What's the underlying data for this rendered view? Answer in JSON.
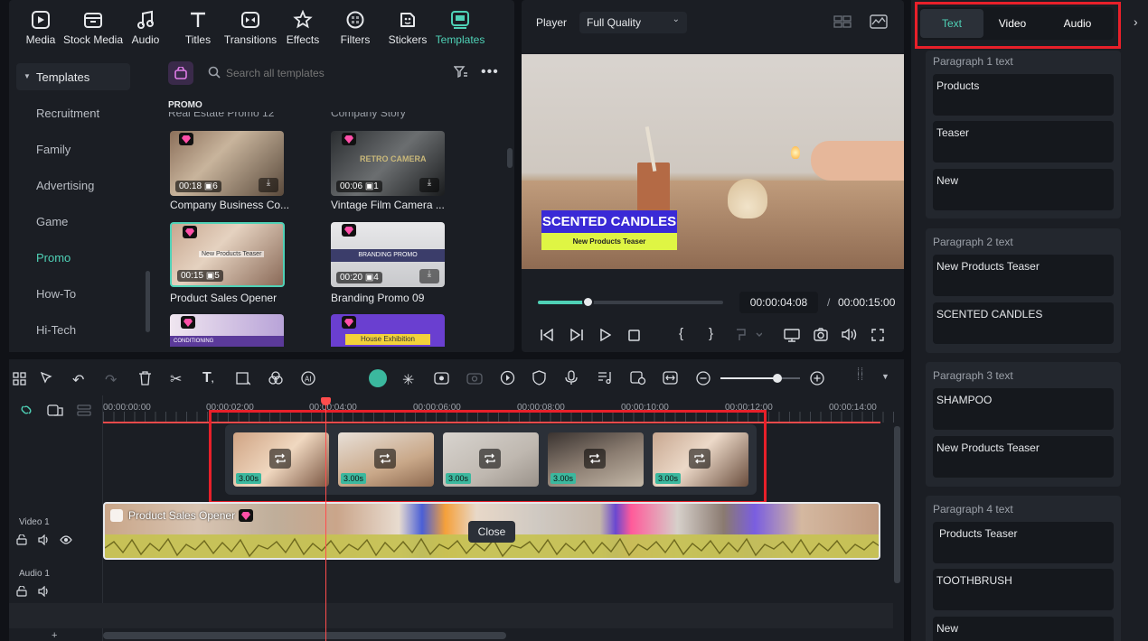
{
  "toolbar": {
    "items": [
      {
        "label": "Media",
        "icon": "media-icon"
      },
      {
        "label": "Stock Media",
        "icon": "stock-media-icon"
      },
      {
        "label": "Audio",
        "icon": "audio-icon"
      },
      {
        "label": "Titles",
        "icon": "titles-icon"
      },
      {
        "label": "Transitions",
        "icon": "transitions-icon"
      },
      {
        "label": "Effects",
        "icon": "effects-icon"
      },
      {
        "label": "Filters",
        "icon": "filters-icon"
      },
      {
        "label": "Stickers",
        "icon": "stickers-icon"
      },
      {
        "label": "Templates",
        "icon": "templates-icon"
      }
    ]
  },
  "sidebar": {
    "header": "Templates",
    "items": [
      "Recruitment",
      "Family",
      "Advertising",
      "Game",
      "Promo",
      "How-To",
      "Hi-Tech"
    ],
    "active": "Promo"
  },
  "search": {
    "placeholder": "Search all templates"
  },
  "grid": {
    "section": "PROMO",
    "cut_top_left": "Real Estate Promo 12",
    "cut_top_right": "Company Story",
    "cards": [
      {
        "caption": "Company Business Co...",
        "duration": "00:18",
        "count": "6"
      },
      {
        "caption": "Vintage Film Camera ...",
        "duration": "00:06",
        "count": "1",
        "overlay": "RETRO CAMERA"
      },
      {
        "caption": "Product Sales Opener",
        "duration": "00:15",
        "count": "5",
        "overlay": "New Products Teaser"
      },
      {
        "caption": "Branding Promo 09",
        "duration": "00:20",
        "count": "4",
        "overlay": "BRANDING PROMO"
      },
      {
        "overlay": "CONDITIONING"
      },
      {
        "overlay": "House Exhibition"
      }
    ]
  },
  "player": {
    "label": "Player",
    "quality": "Full Quality",
    "overlay_title": "SCENTED CANDLES",
    "overlay_sub": "New Products Teaser",
    "current_time": "00:00:04:08",
    "separator": "/",
    "total_time": "00:00:15:00",
    "progress": 0.27
  },
  "right_panel": {
    "tabs": [
      "Text",
      "Video",
      "Audio"
    ],
    "active_tab": "Text",
    "paragraphs": [
      {
        "title": "Paragraph 1 text",
        "texts": [
          "Products",
          "Teaser",
          "New"
        ]
      },
      {
        "title": "Paragraph 2 text",
        "texts": [
          "New Products Teaser",
          "SCENTED CANDLES"
        ]
      },
      {
        "title": "Paragraph 3 text",
        "texts": [
          "SHAMPOO",
          "New Products Teaser"
        ]
      },
      {
        "title": "Paragraph 4 text",
        "texts": [
          "Products Teaser",
          "TOOTHBRUSH",
          "New"
        ]
      }
    ]
  },
  "timeline": {
    "ticks": [
      "00:00:00:00",
      "00:00:02:00",
      "00:00:04:00",
      "00:00:06:00",
      "00:00:08:00",
      "00:00:10:00",
      "00:00:12:00",
      "00:00:14:00"
    ],
    "popup_clips": [
      "3.00s",
      "3.00s",
      "3.00s",
      "3.00s",
      "3.00s"
    ],
    "clip_name": "Product Sales Opener",
    "close_tooltip": "Close",
    "tracks": [
      {
        "name": "Video 1"
      },
      {
        "name": "Audio 1"
      }
    ],
    "zoom": 0.72
  },
  "colors": {
    "accent": "#4fd1b6",
    "highlight": "#e8202a",
    "playhead": "#ff4d4d"
  }
}
